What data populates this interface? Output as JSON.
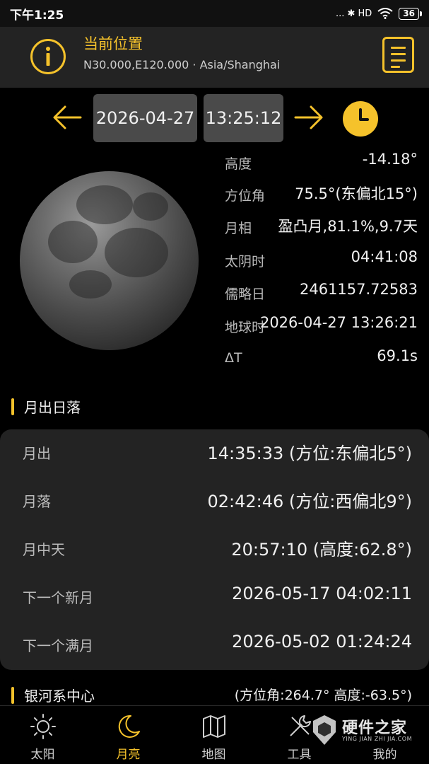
{
  "status_bar": {
    "time": "下午1:25",
    "indicators": "... ✱ HD",
    "battery": "36"
  },
  "header": {
    "title": "当前位置",
    "coordinates": "N30.000,E120.000 · Asia/Shanghai"
  },
  "date_selector": {
    "date": "2026-04-27",
    "time": "13:25:12"
  },
  "moon_info": [
    {
      "label": "高度",
      "value": "-14.18°"
    },
    {
      "label": "方位角",
      "value": "75.5°(东偏北15°)"
    },
    {
      "label": "月相",
      "value": "盈凸月,81.1%,9.7天"
    },
    {
      "label": "太阴时",
      "value": "04:41:08"
    },
    {
      "label": "儒略日",
      "value": "2461157.72583"
    },
    {
      "label": "地球时",
      "value": "2026-04-27 13:26:21"
    },
    {
      "label": "ΔT",
      "value": "69.1s"
    }
  ],
  "rise_set": {
    "title": "月出日落",
    "rows": [
      {
        "label": "月出",
        "value": "14:35:33 (方位:东偏北5°)"
      },
      {
        "label": "月落",
        "value": "02:42:46 (方位:西偏北9°)"
      },
      {
        "label": "月中天",
        "value": "20:57:10 (高度:62.8°)"
      },
      {
        "label": "下一个新月",
        "value": "2026-05-17 04:02:11"
      },
      {
        "label": "下一个满月",
        "value": "2026-05-02 01:24:24"
      }
    ]
  },
  "galaxy": {
    "title": "银河系中心",
    "value": "(方位角:264.7° 高度:-63.5°)"
  },
  "tabs": [
    {
      "label": "太阳",
      "icon": "sun-icon",
      "active": false
    },
    {
      "label": "月亮",
      "icon": "moon-icon",
      "active": true
    },
    {
      "label": "地图",
      "icon": "map-icon",
      "active": false
    },
    {
      "label": "工具",
      "icon": "tools-icon",
      "active": false
    },
    {
      "label": "我的",
      "icon": "profile-icon",
      "active": false
    }
  ],
  "watermark": {
    "text": "硬件之家",
    "sub": "YING JIAN ZHI JIA.COM"
  },
  "colors": {
    "accent": "#f5c22b",
    "panel": "#232323",
    "date_box": "#4a4a4a"
  }
}
